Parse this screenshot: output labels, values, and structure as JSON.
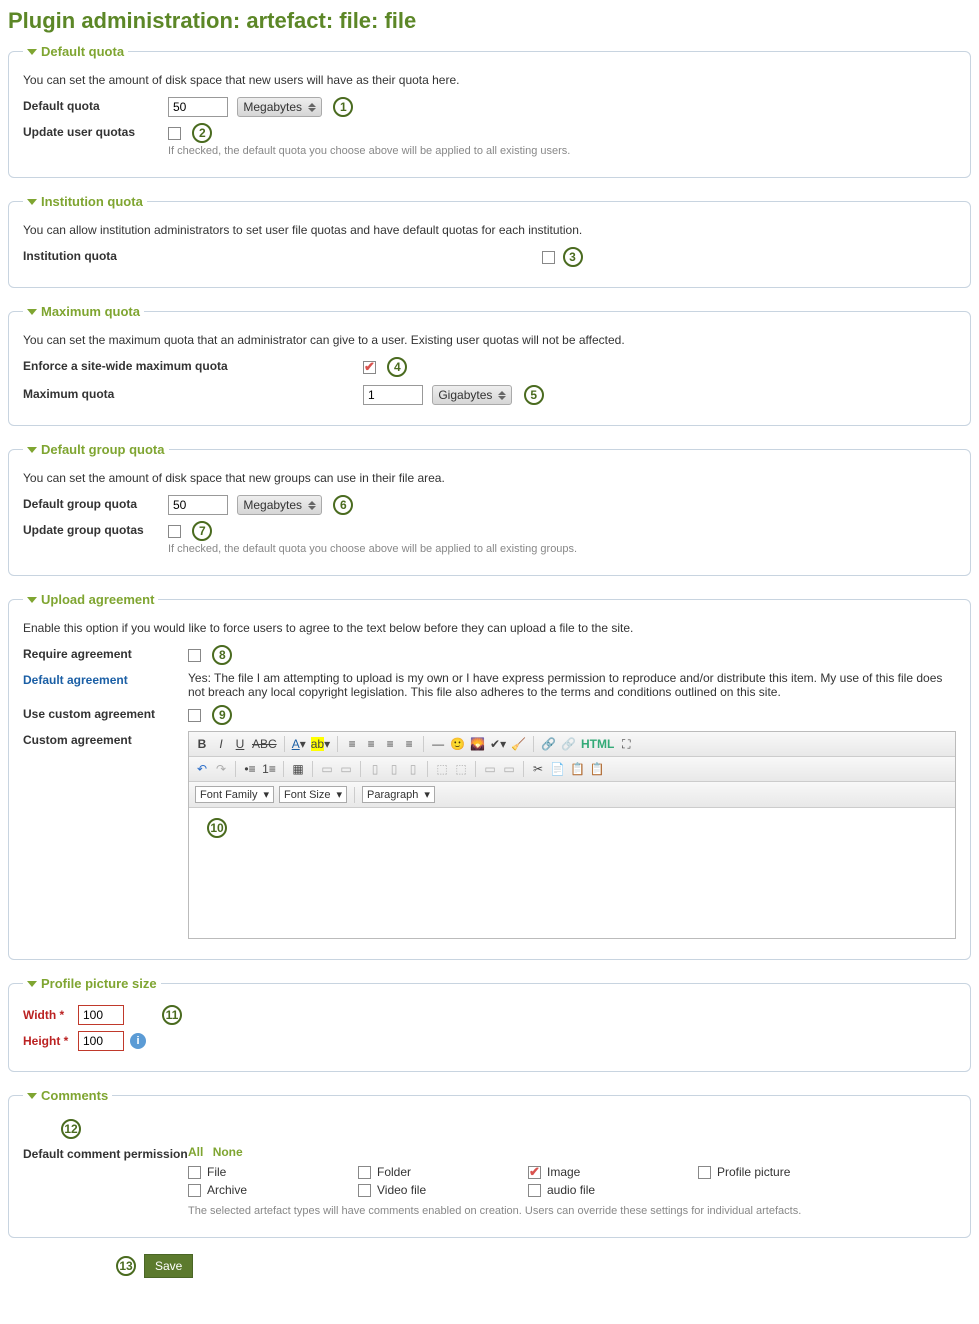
{
  "page_title": "Plugin administration: artefact: file: file",
  "sections": {
    "default_quota": {
      "legend": "Default quota",
      "desc": "You can set the amount of disk space that new users will have as their quota here.",
      "label_quota": "Default quota",
      "value": "50",
      "unit": "Megabytes",
      "label_update": "Update user quotas",
      "update_checked": false,
      "help": "If checked, the default quota you choose above will be applied to all existing users.",
      "annos": {
        "unit": "1",
        "update": "2"
      }
    },
    "institution_quota": {
      "legend": "Institution quota",
      "desc": "You can allow institution administrators to set user file quotas and have default quotas for each institution.",
      "label": "Institution quota",
      "checked": false,
      "anno": "3"
    },
    "maximum_quota": {
      "legend": "Maximum quota",
      "desc": "You can set the maximum quota that an administrator can give to a user. Existing user quotas will not be affected.",
      "label_enforce": "Enforce a site-wide maximum quota",
      "enforce_checked": true,
      "anno_enforce": "4",
      "label_max": "Maximum quota",
      "value": "1",
      "unit": "Gigabytes",
      "anno_unit": "5"
    },
    "default_group_quota": {
      "legend": "Default group quota",
      "desc": "You can set the amount of disk space that new groups can use in their file area.",
      "label_quota": "Default group quota",
      "value": "50",
      "unit": "Megabytes",
      "anno_unit": "6",
      "label_update": "Update group quotas",
      "update_checked": false,
      "anno_update": "7",
      "help": "If checked, the default quota you choose above will be applied to all existing groups."
    },
    "upload_agreement": {
      "legend": "Upload agreement",
      "desc": "Enable this option if you would like to force users to agree to the text below before they can upload a file to the site.",
      "label_require": "Require agreement",
      "require_checked": false,
      "anno_require": "8",
      "label_default": "Default agreement",
      "default_text": "Yes: The file I am attempting to upload is my own or I have express permission to reproduce and/or distribute this item. My use of this file does not breach any local copyright legislation. This file also adheres to the terms and conditions outlined on this site.",
      "label_custom": "Use custom agreement",
      "custom_checked": false,
      "anno_custom": "9",
      "label_custom_area": "Custom agreement",
      "anno_editor": "10",
      "editor": {
        "font_family": "Font Family",
        "font_size": "Font Size",
        "paragraph": "Paragraph",
        "html_label": "HTML"
      }
    },
    "profile_picture": {
      "legend": "Profile picture size",
      "width_label": "Width *",
      "width_value": "100",
      "height_label": "Height *",
      "height_value": "100",
      "anno": "11"
    },
    "comments": {
      "legend": "Comments",
      "anno": "12",
      "label": "Default comment permission",
      "all": "All",
      "none": "None",
      "items": [
        {
          "label": "File",
          "checked": false
        },
        {
          "label": "Folder",
          "checked": false
        },
        {
          "label": "Image",
          "checked": true
        },
        {
          "label": "Profile picture",
          "checked": false
        },
        {
          "label": "Archive",
          "checked": false
        },
        {
          "label": "Video file",
          "checked": false
        },
        {
          "label": "audio file",
          "checked": false
        }
      ],
      "help": "The selected artefact types will have comments enabled on creation. Users can override these settings for individual artefacts."
    }
  },
  "save": {
    "label": "Save",
    "anno": "13"
  }
}
